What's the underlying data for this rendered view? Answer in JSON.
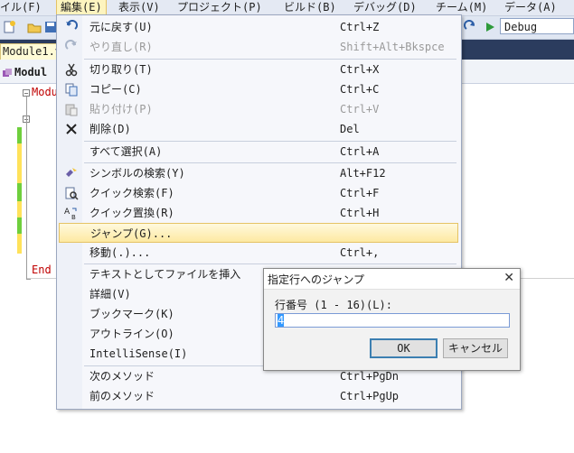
{
  "menubar": {
    "items": [
      "イル(F)",
      "編集(E)",
      "表示(V)",
      "プロジェクト(P)",
      "ビルド(B)",
      "デバッグ(D)",
      "チーム(M)",
      "データ(A)"
    ]
  },
  "toolbar": {
    "config": "Debug"
  },
  "tabs": {
    "doc_tab": "Module1.v"
  },
  "navbar": {
    "class_combo": "Modul"
  },
  "editor": {
    "line1": "Modu",
    "line_end": "End"
  },
  "edit_menu": {
    "items": [
      {
        "label": "元に戻す(U)",
        "shortcut": "Ctrl+Z",
        "icon": "undo-icon",
        "disabled": false
      },
      {
        "label": "やり直し(R)",
        "shortcut": "Shift+Alt+Bkspce",
        "icon": "redo-icon",
        "disabled": true
      },
      {
        "label": "切り取り(T)",
        "shortcut": "Ctrl+X",
        "icon": "cut-icon",
        "disabled": false
      },
      {
        "label": "コピー(C)",
        "shortcut": "Ctrl+C",
        "icon": "copy-icon",
        "disabled": false
      },
      {
        "label": "貼り付け(P)",
        "shortcut": "Ctrl+V",
        "icon": "paste-icon",
        "disabled": true
      },
      {
        "label": "削除(D)",
        "shortcut": "Del",
        "icon": "delete-icon",
        "disabled": false
      },
      {
        "label": "すべて選択(A)",
        "shortcut": "Ctrl+A",
        "icon": "",
        "disabled": false
      },
      {
        "label": "シンボルの検索(Y)",
        "shortcut": "Alt+F12",
        "icon": "find-symbol-icon",
        "disabled": false
      },
      {
        "label": "クイック検索(F)",
        "shortcut": "Ctrl+F",
        "icon": "quick-find-icon",
        "disabled": false
      },
      {
        "label": "クイック置換(R)",
        "shortcut": "Ctrl+H",
        "icon": "quick-replace-icon",
        "disabled": false
      },
      {
        "label": "ジャンプ(G)...",
        "shortcut": "",
        "icon": "",
        "disabled": false
      },
      {
        "label": "移動(.)...",
        "shortcut": "Ctrl+,",
        "icon": "",
        "disabled": false
      },
      {
        "label": "テキストとしてファイルを挿入",
        "shortcut": "",
        "icon": "",
        "disabled": false
      },
      {
        "label": "詳細(V)",
        "shortcut": "",
        "icon": "",
        "disabled": false
      },
      {
        "label": "ブックマーク(K)",
        "shortcut": "",
        "icon": "",
        "disabled": false
      },
      {
        "label": "アウトライン(O)",
        "shortcut": "",
        "icon": "",
        "disabled": false
      },
      {
        "label": "IntelliSense(I)",
        "shortcut": "",
        "icon": "",
        "disabled": false
      },
      {
        "label": "次のメソッド",
        "shortcut": "Ctrl+PgDn",
        "icon": "",
        "disabled": false
      },
      {
        "label": "前のメソッド",
        "shortcut": "Ctrl+PgUp",
        "icon": "",
        "disabled": false
      }
    ]
  },
  "dialog": {
    "title": "指定行へのジャンプ",
    "close": "✕",
    "label": "行番号 (1 - 16)(L):",
    "value": "4",
    "ok": "OK",
    "cancel": "キャンセル"
  }
}
